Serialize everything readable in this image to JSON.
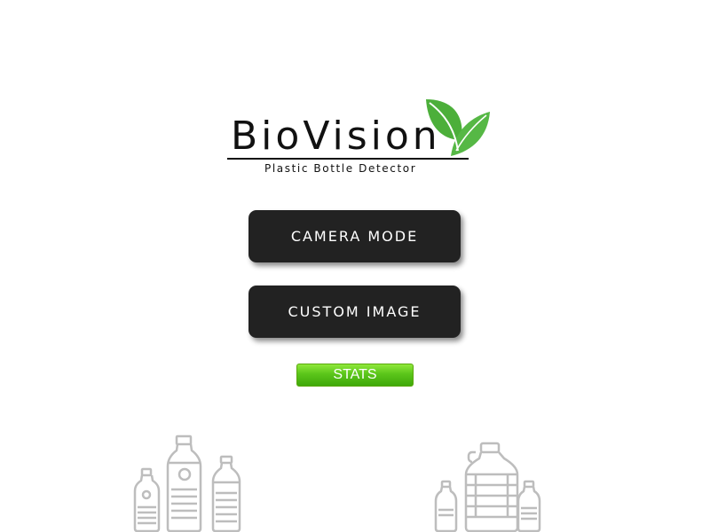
{
  "logo": {
    "title": "BioVision",
    "subtitle": "Plastic Bottle Detector",
    "icon": "leaf-icon"
  },
  "buttons": {
    "camera_mode": "CAMERA MODE",
    "custom_image": "CUSTOM IMAGE",
    "stats": "STATS"
  },
  "illustrations": {
    "left": "plastic-bottles-icon",
    "right": "water-jug-bottles-icon"
  },
  "colors": {
    "leaf": "#4caf3a",
    "button_dark": "#222222",
    "stats_green": "#5bc51a",
    "illustration_gray": "#bdbdbd"
  }
}
